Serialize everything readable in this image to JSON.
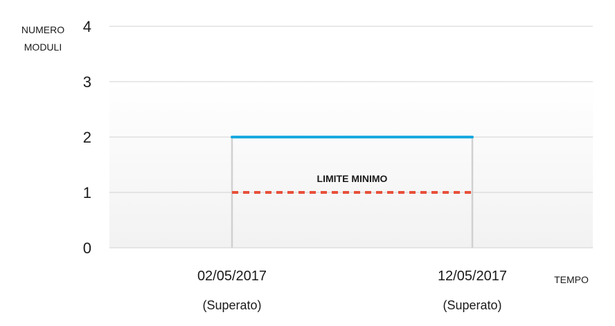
{
  "chart_data": {
    "type": "line",
    "ylabel_lines": [
      "NUMERO",
      "MODULI"
    ],
    "xlabel": "TEMPO",
    "ylim": [
      0,
      4
    ],
    "yticks": [
      "0",
      "1",
      "2",
      "3",
      "4"
    ],
    "categories": [
      "02/05/2017",
      "12/05/2017"
    ],
    "category_sublabels": [
      "(Superato)",
      "(Superato)"
    ],
    "grid": true,
    "series": [
      {
        "values": [
          2,
          2
        ],
        "color": "#19a9e0",
        "style": "solid"
      },
      {
        "name": "LIMITE MINIMO",
        "values": [
          1,
          1
        ],
        "color": "#e8503a",
        "style": "dashed"
      }
    ],
    "colors": {
      "gridline": "#d9d9d9",
      "drop_line": "#d0d0d0",
      "plot_gradient_top": "#ffffff",
      "plot_gradient_bottom": "#f2f2f2"
    }
  }
}
